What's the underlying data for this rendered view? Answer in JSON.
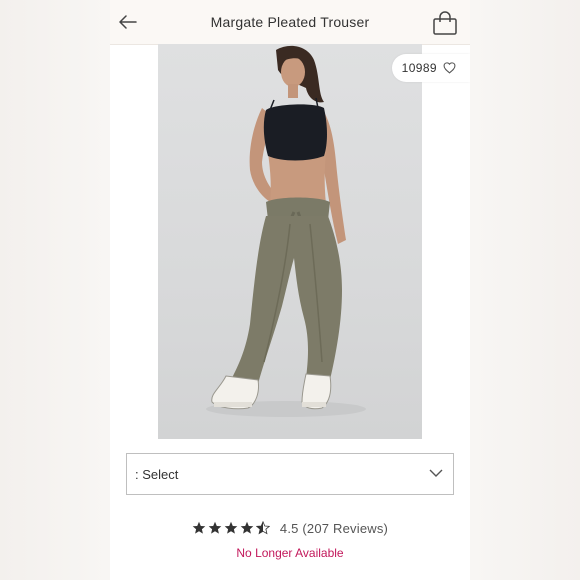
{
  "header": {
    "title": "Margate Pleated Trouser",
    "back_icon": "arrow-left-icon",
    "bag_icon": "shopping-bag-icon"
  },
  "product": {
    "likes": "10989",
    "heart_icon": "heart-outline-icon"
  },
  "size_select": {
    "label": ": Select",
    "chevron_icon": "chevron-down-icon"
  },
  "rating": {
    "value": 4.5,
    "max": 5,
    "text": "4.5 (207 Reviews)"
  },
  "availability": {
    "text": "No Longer Available",
    "color": "#c2185b"
  }
}
